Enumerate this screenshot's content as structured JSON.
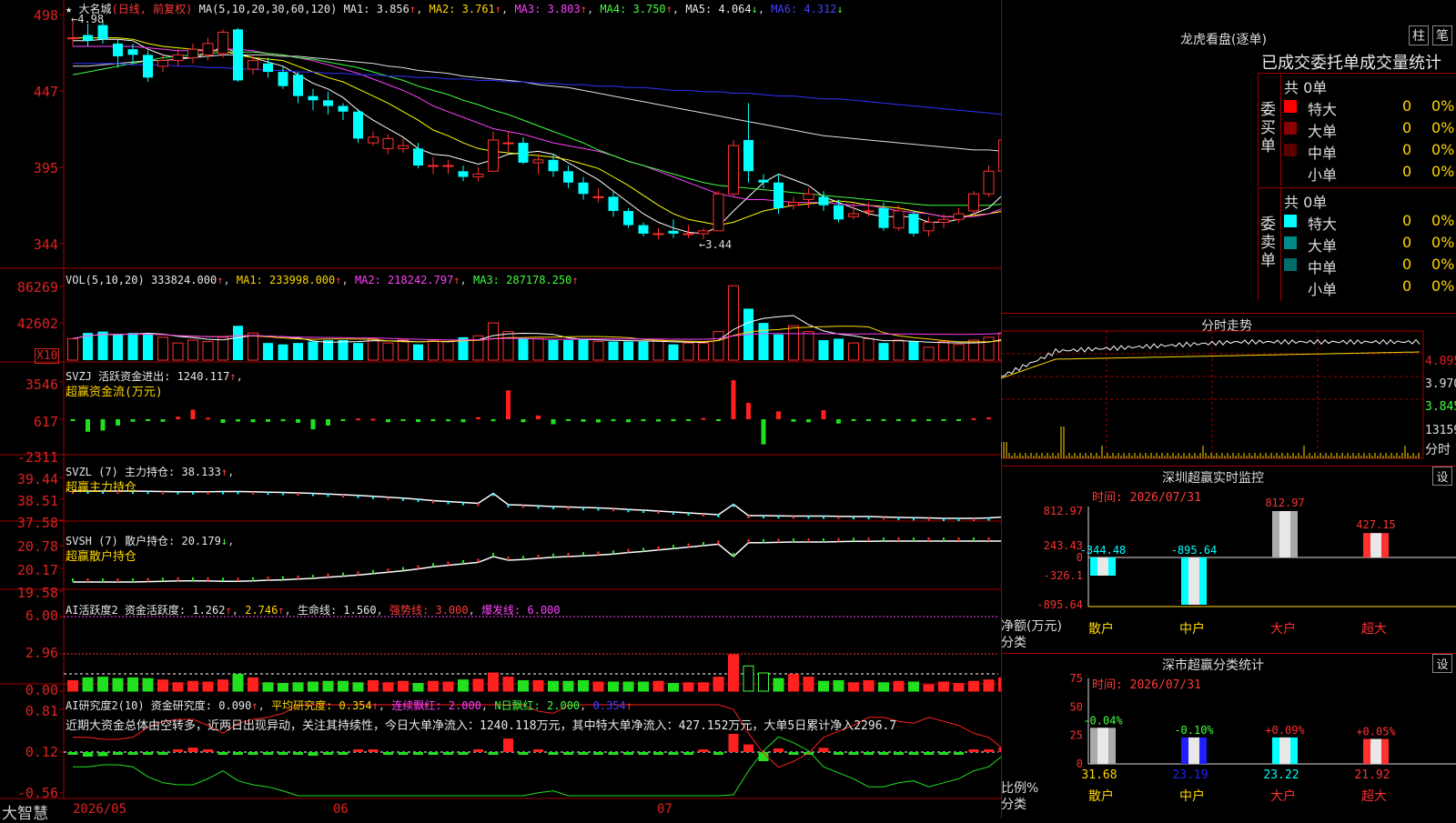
{
  "app_name": "大智慧",
  "main_chart": {
    "name": "大名城",
    "mode": "(日线, 前复权)",
    "ma_caption": "MA(5,10,20,30,60,120)",
    "ma1": "MA1: 3.856",
    "ma2": "MA2: 3.761",
    "ma3": "MA3: 3.803",
    "ma4": "MA4: 3.750",
    "ma5": "MA5: 4.064",
    "ma6": "MA6: 4.312",
    "high_mark": "4.98",
    "low_mark": "3.44",
    "y_ticks": [
      "498",
      "447",
      "395",
      "344"
    ]
  },
  "vol_panel": {
    "caption": "VOL(5,10,20)",
    "value": "333824.000",
    "ma1": "MA1: 233998.000",
    "ma2": "MA2: 218242.797",
    "ma3": "MA3: 287178.250",
    "y_ticks": [
      "86269",
      "42602"
    ],
    "unit": "X10"
  },
  "svzj_panel": {
    "caption": "SVZJ  活跃资金进出: 1240.117",
    "subtitle": "超赢资金流(万元)",
    "y_ticks": [
      "3546",
      "617",
      "-2311"
    ]
  },
  "svzl_panel": {
    "caption": "SVZL (7) 主力持仓: 38.133",
    "subtitle": "超赢主力持仓",
    "y_ticks": [
      "39.44",
      "38.51",
      "37.58"
    ]
  },
  "svsh_panel": {
    "caption": "SVSH (7) 散户持仓: 20.179",
    "subtitle": "超赢散户持仓",
    "y_ticks": [
      "20.78",
      "20.17",
      "19.58"
    ]
  },
  "ai1_panel": {
    "caption_a": "AI活跃度2 资金活跃度: 1.262",
    "caption_b": "2.746",
    "caption_c": "生命线: 1.560",
    "caption_d": "强势线: 3.000",
    "caption_e": "爆发线: 6.000",
    "y_ticks": [
      "6.00",
      "2.96",
      "0.00"
    ]
  },
  "ai2_panel": {
    "caption_a": "AI研究度2(10) 资金研究度: 0.090",
    "caption_b": "平均研究度: 0.354",
    "caption_c": "连续飘红: 2.000",
    "caption_d": "N日飘红: 2.000",
    "caption_e": "0.354",
    "comment": "近期大资金总体由空转多，近两日出现异动，关注其持续性，今日大单净流入：1240.118万元，其中特大单净流入：427.152万元，大单5日累计净入2296.7",
    "y_ticks": [
      "0.81",
      "0.12",
      "-0.56"
    ]
  },
  "x_axis": {
    "labels": [
      "2026/05",
      "06",
      "07"
    ]
  },
  "dragon_tiger": {
    "title": "龙虎看盘(逐单)",
    "btn_a": "柱",
    "btn_b": "笔",
    "subtitle": "已成交委托单成交量统计",
    "buy_label": "委买单",
    "sell_label": "委卖单",
    "buy_total": "共 0单",
    "sell_total": "共 0单",
    "buy_rows": [
      {
        "label": "特大",
        "count": "0",
        "pct": "0%",
        "color": "#ff0000"
      },
      {
        "label": "大单",
        "count": "0",
        "pct": "0%",
        "color": "#8b0000"
      },
      {
        "label": "中单",
        "count": "0",
        "pct": "0%",
        "color": "#5a0000"
      },
      {
        "label": "小单",
        "count": "0",
        "pct": "0%",
        "color": "#000000"
      }
    ],
    "sell_rows": [
      {
        "label": "特大",
        "count": "0",
        "pct": "0%",
        "color": "#00ffff"
      },
      {
        "label": "大单",
        "count": "0",
        "pct": "0%",
        "color": "#008b8b"
      },
      {
        "label": "中单",
        "count": "0",
        "pct": "0%",
        "color": "#006b6b"
      },
      {
        "label": "小单",
        "count": "0",
        "pct": "0%",
        "color": "#000000"
      }
    ]
  },
  "intraday": {
    "title": "分时走势",
    "y_ticks": [
      "4.095",
      "3.970",
      "3.845"
    ],
    "vol_label": "13159",
    "unit_label": "分时"
  },
  "sz_monitor": {
    "title": "深圳超赢实时监控",
    "set_label": "设",
    "time": "时间: 2026/07/31",
    "y_ticks": [
      "812.97",
      "243.43",
      "0",
      "-326.1",
      "-895.64"
    ],
    "ylabel": "净额(万元)",
    "cat_label": "分类",
    "categories": [
      "散户",
      "中户",
      "大户",
      "超大"
    ],
    "values": [
      -344.48,
      -895.64,
      812.97,
      427.15
    ],
    "value_labels": [
      "-344.48",
      "-895.64",
      "812.97",
      "427.15"
    ]
  },
  "sz_stats": {
    "title": "深市超赢分类统计",
    "set_label": "设",
    "time": "时间: 2026/07/31",
    "y_ticks": [
      "75",
      "50",
      "25",
      "0"
    ],
    "ylabel": "比例%",
    "cat_label": "分类",
    "categories": [
      "散户",
      "中户",
      "大户",
      "超大"
    ],
    "values": [
      31.68,
      23.19,
      23.22,
      21.92
    ],
    "value_labels": [
      "31.68",
      "23.19",
      "23.22",
      "21.92"
    ],
    "changes": [
      "-0.04%",
      "-0.10%",
      "+0.09%",
      "+0.05%"
    ]
  },
  "chart_data": {
    "type": "candlestick",
    "title": "大名城",
    "ylim": [
      3.3,
      5.05
    ],
    "candles": [
      {
        "o": 4.86,
        "c": 4.86,
        "h": 4.98,
        "l": 4.8
      },
      {
        "o": 4.88,
        "c": 4.84,
        "h": 4.96,
        "l": 4.8
      },
      {
        "o": 4.95,
        "c": 4.85,
        "h": 4.98,
        "l": 4.82
      },
      {
        "o": 4.82,
        "c": 4.73,
        "h": 4.85,
        "l": 4.65
      },
      {
        "o": 4.78,
        "c": 4.74,
        "h": 4.82,
        "l": 4.68
      },
      {
        "o": 4.74,
        "c": 4.58,
        "h": 4.77,
        "l": 4.55
      },
      {
        "o": 4.66,
        "c": 4.7,
        "h": 4.74,
        "l": 4.62
      },
      {
        "o": 4.7,
        "c": 4.74,
        "h": 4.78,
        "l": 4.66
      },
      {
        "o": 4.72,
        "c": 4.78,
        "h": 4.82,
        "l": 4.68
      },
      {
        "o": 4.74,
        "c": 4.82,
        "h": 4.86,
        "l": 4.7
      },
      {
        "o": 4.75,
        "c": 4.9,
        "h": 4.92,
        "l": 4.72
      },
      {
        "o": 4.92,
        "c": 4.56,
        "h": 4.93,
        "l": 4.55
      },
      {
        "o": 4.64,
        "c": 4.7,
        "h": 4.74,
        "l": 4.6
      },
      {
        "o": 4.68,
        "c": 4.62,
        "h": 4.72,
        "l": 4.58
      },
      {
        "o": 4.62,
        "c": 4.52,
        "h": 4.66,
        "l": 4.5
      },
      {
        "o": 4.6,
        "c": 4.45,
        "h": 4.62,
        "l": 4.4
      },
      {
        "o": 4.45,
        "c": 4.42,
        "h": 4.5,
        "l": 4.35
      },
      {
        "o": 4.42,
        "c": 4.38,
        "h": 4.48,
        "l": 4.32
      },
      {
        "o": 4.38,
        "c": 4.34,
        "h": 4.4,
        "l": 4.28
      },
      {
        "o": 4.34,
        "c": 4.15,
        "h": 4.36,
        "l": 4.12
      },
      {
        "o": 4.12,
        "c": 4.16,
        "h": 4.2,
        "l": 4.1
      },
      {
        "o": 4.08,
        "c": 4.15,
        "h": 4.18,
        "l": 4.04
      },
      {
        "o": 4.08,
        "c": 4.1,
        "h": 4.15,
        "l": 4.05
      },
      {
        "o": 4.08,
        "c": 3.96,
        "h": 4.12,
        "l": 3.94
      },
      {
        "o": 3.96,
        "c": 3.96,
        "h": 4.02,
        "l": 3.9
      },
      {
        "o": 3.96,
        "c": 3.96,
        "h": 4.0,
        "l": 3.9
      },
      {
        "o": 3.92,
        "c": 3.88,
        "h": 3.96,
        "l": 3.85
      },
      {
        "o": 3.88,
        "c": 3.9,
        "h": 3.95,
        "l": 3.85
      },
      {
        "o": 3.92,
        "c": 4.14,
        "h": 4.2,
        "l": 3.92
      },
      {
        "o": 4.12,
        "c": 4.12,
        "h": 4.2,
        "l": 4.06
      },
      {
        "o": 4.12,
        "c": 3.98,
        "h": 4.16,
        "l": 3.97
      },
      {
        "o": 3.98,
        "c": 4.0,
        "h": 4.04,
        "l": 3.9
      },
      {
        "o": 4.0,
        "c": 3.92,
        "h": 4.04,
        "l": 3.88
      },
      {
        "o": 3.92,
        "c": 3.84,
        "h": 3.96,
        "l": 3.8
      },
      {
        "o": 3.84,
        "c": 3.76,
        "h": 3.88,
        "l": 3.72
      },
      {
        "o": 3.74,
        "c": 3.74,
        "h": 3.8,
        "l": 3.7
      },
      {
        "o": 3.74,
        "c": 3.64,
        "h": 3.78,
        "l": 3.6
      },
      {
        "o": 3.64,
        "c": 3.54,
        "h": 3.66,
        "l": 3.52
      },
      {
        "o": 3.54,
        "c": 3.48,
        "h": 3.56,
        "l": 3.46
      },
      {
        "o": 3.48,
        "c": 3.48,
        "h": 3.52,
        "l": 3.44
      },
      {
        "o": 3.5,
        "c": 3.48,
        "h": 3.58,
        "l": 3.45
      },
      {
        "o": 3.48,
        "c": 3.48,
        "h": 3.54,
        "l": 3.45
      },
      {
        "o": 3.48,
        "c": 3.5,
        "h": 3.52,
        "l": 3.44
      },
      {
        "o": 3.5,
        "c": 3.76,
        "h": 3.78,
        "l": 3.5
      },
      {
        "o": 3.76,
        "c": 4.1,
        "h": 4.14,
        "l": 3.74
      },
      {
        "o": 4.14,
        "c": 3.92,
        "h": 4.4,
        "l": 3.84
      },
      {
        "o": 3.86,
        "c": 3.84,
        "h": 3.9,
        "l": 3.8
      },
      {
        "o": 3.84,
        "c": 3.66,
        "h": 3.9,
        "l": 3.62
      },
      {
        "o": 3.68,
        "c": 3.7,
        "h": 3.74,
        "l": 3.65
      },
      {
        "o": 3.72,
        "c": 3.76,
        "h": 3.8,
        "l": 3.66
      },
      {
        "o": 3.74,
        "c": 3.68,
        "h": 3.78,
        "l": 3.64
      },
      {
        "o": 3.68,
        "c": 3.58,
        "h": 3.72,
        "l": 3.56
      },
      {
        "o": 3.6,
        "c": 3.62,
        "h": 3.7,
        "l": 3.58
      },
      {
        "o": 3.64,
        "c": 3.64,
        "h": 3.7,
        "l": 3.6
      },
      {
        "o": 3.66,
        "c": 3.52,
        "h": 3.7,
        "l": 3.5
      },
      {
        "o": 3.52,
        "c": 3.64,
        "h": 3.68,
        "l": 3.5
      },
      {
        "o": 3.62,
        "c": 3.48,
        "h": 3.64,
        "l": 3.46
      },
      {
        "o": 3.5,
        "c": 3.56,
        "h": 3.6,
        "l": 3.46
      },
      {
        "o": 3.56,
        "c": 3.58,
        "h": 3.62,
        "l": 3.52
      },
      {
        "o": 3.58,
        "c": 3.62,
        "h": 3.66,
        "l": 3.56
      },
      {
        "o": 3.64,
        "c": 3.76,
        "h": 3.78,
        "l": 3.6
      },
      {
        "o": 3.76,
        "c": 3.92,
        "h": 3.96,
        "l": 3.74
      },
      {
        "o": 3.92,
        "c": 4.14,
        "h": 4.18,
        "l": 3.88
      },
      {
        "o": 3.9,
        "c": 4.15,
        "h": 4.2,
        "l": 3.88
      }
    ],
    "ma_series": [
      {
        "name": "MA1",
        "color": "#ffffff",
        "values": [
          4.84,
          4.84,
          4.85,
          4.85,
          4.84,
          4.78,
          4.74,
          4.72,
          4.72,
          4.75,
          4.8,
          4.75,
          4.72,
          4.69,
          4.66,
          4.6,
          4.54,
          4.5,
          4.44,
          4.35,
          4.28,
          4.22,
          4.16,
          4.08,
          4.04,
          4.03,
          4.0,
          3.97,
          4.0,
          4.04,
          4.05,
          4.06,
          4.04,
          3.98,
          3.92,
          3.86,
          3.78,
          3.7,
          3.62,
          3.56,
          3.52,
          3.49,
          3.48,
          3.53,
          3.64,
          3.74,
          3.84,
          3.9,
          3.86,
          3.82,
          3.74,
          3.7,
          3.66,
          3.62,
          3.6,
          3.6,
          3.6,
          3.56,
          3.56,
          3.58,
          3.62,
          3.66,
          3.76,
          3.86
        ]
      },
      {
        "name": "MA2",
        "color": "#ffff00",
        "values": [
          4.86,
          4.86,
          4.86,
          4.86,
          4.85,
          4.82,
          4.8,
          4.79,
          4.78,
          4.77,
          4.77,
          4.74,
          4.72,
          4.71,
          4.7,
          4.66,
          4.62,
          4.58,
          4.55,
          4.5,
          4.45,
          4.4,
          4.34,
          4.28,
          4.21,
          4.17,
          4.12,
          4.08,
          4.06,
          4.05,
          4.04,
          4.03,
          4.02,
          4.0,
          3.97,
          3.94,
          3.88,
          3.82,
          3.75,
          3.68,
          3.62,
          3.58,
          3.56,
          3.54,
          3.56,
          3.6,
          3.64,
          3.66,
          3.68,
          3.69,
          3.7,
          3.71,
          3.7,
          3.68,
          3.67,
          3.66,
          3.64,
          3.62,
          3.6,
          3.6,
          3.61,
          3.62,
          3.64,
          3.7
        ]
      },
      {
        "name": "MA3",
        "color": "#ff40ff",
        "values": [
          4.8,
          4.8,
          4.8,
          4.8,
          4.8,
          4.79,
          4.78,
          4.77,
          4.77,
          4.77,
          4.78,
          4.78,
          4.77,
          4.75,
          4.74,
          4.72,
          4.7,
          4.67,
          4.64,
          4.61,
          4.57,
          4.53,
          4.49,
          4.44,
          4.38,
          4.34,
          4.3,
          4.26,
          4.22,
          4.2,
          4.18,
          4.15,
          4.12,
          4.1,
          4.08,
          4.06,
          4.03,
          3.99,
          3.96,
          3.92,
          3.88,
          3.84,
          3.8,
          3.76,
          3.74,
          3.72,
          3.72,
          3.71,
          3.7,
          3.7,
          3.7,
          3.69,
          3.68,
          3.68,
          3.66,
          3.64,
          3.63,
          3.62,
          3.6,
          3.6,
          3.6,
          3.62,
          3.66,
          3.76
        ]
      },
      {
        "name": "MA4",
        "color": "#40ff40",
        "values": [
          4.6,
          4.62,
          4.64,
          4.66,
          4.68,
          4.7,
          4.72,
          4.73,
          4.74,
          4.75,
          4.76,
          4.76,
          4.76,
          4.75,
          4.74,
          4.72,
          4.71,
          4.69,
          4.67,
          4.65,
          4.62,
          4.59,
          4.56,
          4.52,
          4.49,
          4.46,
          4.42,
          4.39,
          4.35,
          4.32,
          4.28,
          4.24,
          4.2,
          4.16,
          4.12,
          4.07,
          4.03,
          3.99,
          3.96,
          3.93,
          3.9,
          3.87,
          3.84,
          3.82,
          3.81,
          3.8,
          3.79,
          3.78,
          3.77,
          3.76,
          3.75,
          3.74,
          3.73,
          3.72,
          3.71,
          3.7,
          3.69,
          3.68,
          3.68,
          3.68,
          3.68,
          3.68,
          3.69,
          3.75
        ]
      },
      {
        "name": "MA5",
        "color": "#e0e0e0",
        "values": [
          4.66,
          4.66,
          4.67,
          4.68,
          4.69,
          4.7,
          4.7,
          4.71,
          4.72,
          4.73,
          4.74,
          4.74,
          4.74,
          4.74,
          4.73,
          4.73,
          4.72,
          4.71,
          4.7,
          4.69,
          4.68,
          4.66,
          4.65,
          4.63,
          4.62,
          4.61,
          4.59,
          4.58,
          4.57,
          4.56,
          4.55,
          4.53,
          4.52,
          4.51,
          4.49,
          4.47,
          4.45,
          4.43,
          4.41,
          4.39,
          4.37,
          4.35,
          4.33,
          4.31,
          4.29,
          4.27,
          4.25,
          4.23,
          4.21,
          4.19,
          4.17,
          4.16,
          4.15,
          4.14,
          4.13,
          4.12,
          4.11,
          4.1,
          4.09,
          4.08,
          4.07,
          4.07,
          4.06,
          4.06
        ]
      },
      {
        "name": "MA6",
        "color": "#3030ff",
        "values": [
          4.68,
          4.68,
          4.68,
          4.68,
          4.67,
          4.67,
          4.67,
          4.66,
          4.66,
          4.65,
          4.65,
          4.64,
          4.64,
          4.63,
          4.63,
          4.62,
          4.62,
          4.61,
          4.61,
          4.6,
          4.6,
          4.59,
          4.59,
          4.58,
          4.58,
          4.57,
          4.57,
          4.56,
          4.56,
          4.55,
          4.55,
          4.54,
          4.54,
          4.53,
          4.53,
          4.52,
          4.52,
          4.51,
          4.51,
          4.5,
          4.49,
          4.49,
          4.48,
          4.48,
          4.47,
          4.47,
          4.46,
          4.45,
          4.45,
          4.44,
          4.43,
          4.43,
          4.42,
          4.41,
          4.4,
          4.39,
          4.38,
          4.37,
          4.36,
          4.35,
          4.34,
          4.33,
          4.32,
          4.31
        ]
      }
    ],
    "volume": [
      150,
      190,
      200,
      180,
      190,
      180,
      160,
      120,
      140,
      130,
      160,
      240,
      190,
      120,
      110,
      120,
      130,
      140,
      140,
      120,
      150,
      120,
      140,
      110,
      140,
      130,
      160,
      170,
      260,
      200,
      150,
      150,
      140,
      140,
      150,
      130,
      130,
      130,
      130,
      140,
      110,
      120,
      120,
      200,
      520,
      360,
      260,
      180,
      240,
      200,
      140,
      150,
      120,
      150,
      120,
      140,
      130,
      90,
      130,
      110,
      140,
      160,
      190,
      200
    ],
    "svzj": [
      -10,
      -500,
      -450,
      -250,
      -100,
      -50,
      -100,
      100,
      380,
      60,
      -150,
      -90,
      -120,
      -100,
      -80,
      -140,
      -400,
      -250,
      -50,
      30,
      20,
      -120,
      -70,
      -110,
      -80,
      -80,
      -120,
      80,
      -80,
      1150,
      -120,
      150,
      -200,
      -60,
      -100,
      -130,
      -80,
      -120,
      -80,
      -90,
      -80,
      -60,
      50,
      -20,
      1550,
      650,
      -1000,
      310,
      -100,
      -120,
      360,
      -170,
      -60,
      -20,
      -20,
      -20,
      -90,
      -40,
      -50,
      -60,
      40,
      70,
      400,
      600
    ]
  }
}
